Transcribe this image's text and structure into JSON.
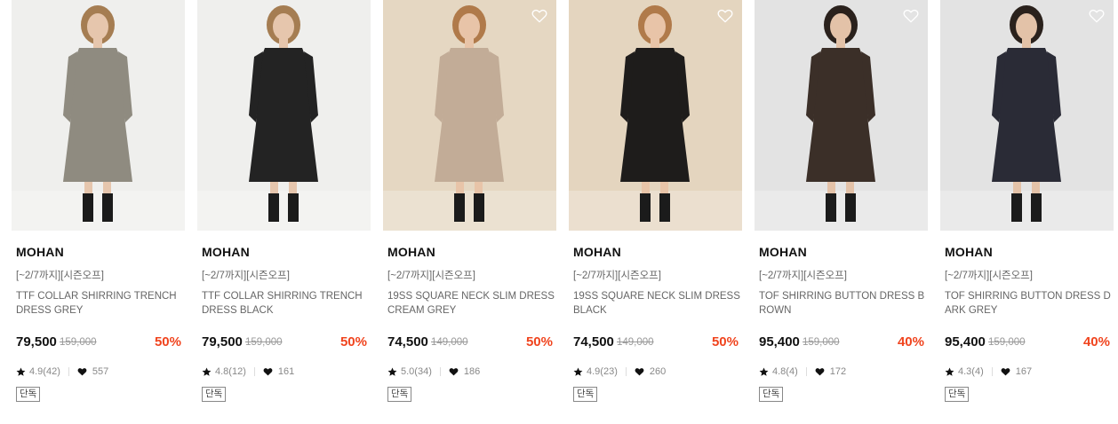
{
  "products": [
    {
      "brand": "MOHAN",
      "promo": "[~2/7까지][시즌오프]",
      "name": "TTF COLLAR SHIRRING TRENCH DRESS GREY",
      "price": "79,500",
      "original_price": "159,000",
      "discount": "50%",
      "rating": "4.9(42)",
      "likes": "557",
      "badge": "단독",
      "colors": {
        "bg": "#efefed",
        "dress": "#8f8b80",
        "skin": "#e6c6ad",
        "hair": "#a57d52"
      },
      "heart_visible": false
    },
    {
      "brand": "MOHAN",
      "promo": "[~2/7까지][시즌오프]",
      "name": "TTF COLLAR SHIRRING TRENCH DRESS BLACK",
      "price": "79,500",
      "original_price": "159,000",
      "discount": "50%",
      "rating": "4.8(12)",
      "likes": "161",
      "badge": "단독",
      "colors": {
        "bg": "#efefed",
        "dress": "#232323",
        "skin": "#e6c6ad",
        "hair": "#a57d52"
      },
      "heart_visible": false
    },
    {
      "brand": "MOHAN",
      "promo": "[~2/7까지][시즌오프]",
      "name": "19SS SQUARE NECK SLIM DRESS CREAM GREY",
      "price": "74,500",
      "original_price": "149,000",
      "discount": "50%",
      "rating": "5.0(34)",
      "likes": "186",
      "badge": "단독",
      "colors": {
        "bg": "#e5d7c2",
        "dress": "#c2ac97",
        "skin": "#e8c4a8",
        "hair": "#b07a4a"
      },
      "heart_visible": true
    },
    {
      "brand": "MOHAN",
      "promo": "[~2/7까지][시즌오프]",
      "name": "19SS SQUARE NECK SLIM DRESS BLACK",
      "price": "74,500",
      "original_price": "149,000",
      "discount": "50%",
      "rating": "4.9(23)",
      "likes": "260",
      "badge": "단독",
      "colors": {
        "bg": "#e4d5bf",
        "dress": "#1e1c1b",
        "skin": "#e8c4a8",
        "hair": "#b07a4a"
      },
      "heart_visible": true
    },
    {
      "brand": "MOHAN",
      "promo": "[~2/7까지][시즌오프]",
      "name": "TOF SHIRRING BUTTON DRESS BROWN",
      "price": "95,400",
      "original_price": "159,000",
      "discount": "40%",
      "rating": "4.8(4)",
      "likes": "172",
      "badge": "단독",
      "colors": {
        "bg": "#e3e3e3",
        "dress": "#3b2f28",
        "skin": "#e3c2a8",
        "hair": "#2a211c"
      },
      "heart_visible": true
    },
    {
      "brand": "MOHAN",
      "promo": "[~2/7까지][시즌오프]",
      "name": "TOF SHIRRING BUTTON DRESS DARK GREY",
      "price": "95,400",
      "original_price": "159,000",
      "discount": "40%",
      "rating": "4.3(4)",
      "likes": "167",
      "badge": "단독",
      "colors": {
        "bg": "#e3e3e3",
        "dress": "#2a2b36",
        "skin": "#e3c2a8",
        "hair": "#2a211c"
      },
      "heart_visible": true
    }
  ],
  "icons": {
    "rating": "star-icon",
    "likes": "heart-icon",
    "wishlist": "heart-outline-icon"
  },
  "accent_colors": {
    "discount": "#f0441e",
    "text_muted": "#666666"
  }
}
